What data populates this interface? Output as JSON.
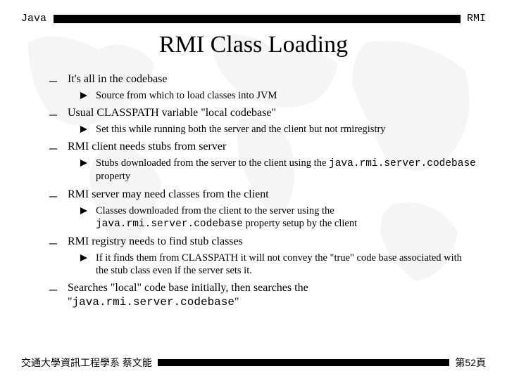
{
  "header": {
    "left": "Java",
    "right": "RMI"
  },
  "title": "RMI Class Loading",
  "items": [
    {
      "text": "It's all in the codebase",
      "sub": [
        {
          "text": "Source from which to load classes into JVM"
        }
      ]
    },
    {
      "text": "Usual CLASSPATH variable \"local codebase\"",
      "sub": [
        {
          "text": "Set this while running both the server and the client but not rmiregistry"
        }
      ]
    },
    {
      "text": "RMI client needs stubs from server",
      "sub": [
        {
          "text": "Stubs downloaded from the server to the client using the ",
          "code": "java.rmi.server.codebase",
          "after": " property"
        }
      ]
    },
    {
      "text": "RMI server may need classes from the client",
      "sub": [
        {
          "text": "Classes downloaded from the client to the server using the ",
          "code": "java.rmi.server.codebase",
          "after": " property setup by the client"
        }
      ]
    },
    {
      "text": "RMI registry needs to find stub classes",
      "sub": [
        {
          "text": "If it finds them from CLASSPATH it will not convey the \"true\" code base associated with the stub class even if the server sets it."
        }
      ]
    },
    {
      "text_pre": "Searches \"local\" code base initially, then searches the \"",
      "code": "java.rmi.server.codebase",
      "text_post": "\"",
      "sub": []
    }
  ],
  "footer": {
    "left": "交通大學資訊工程學系 蔡文能",
    "right": "第52頁"
  }
}
